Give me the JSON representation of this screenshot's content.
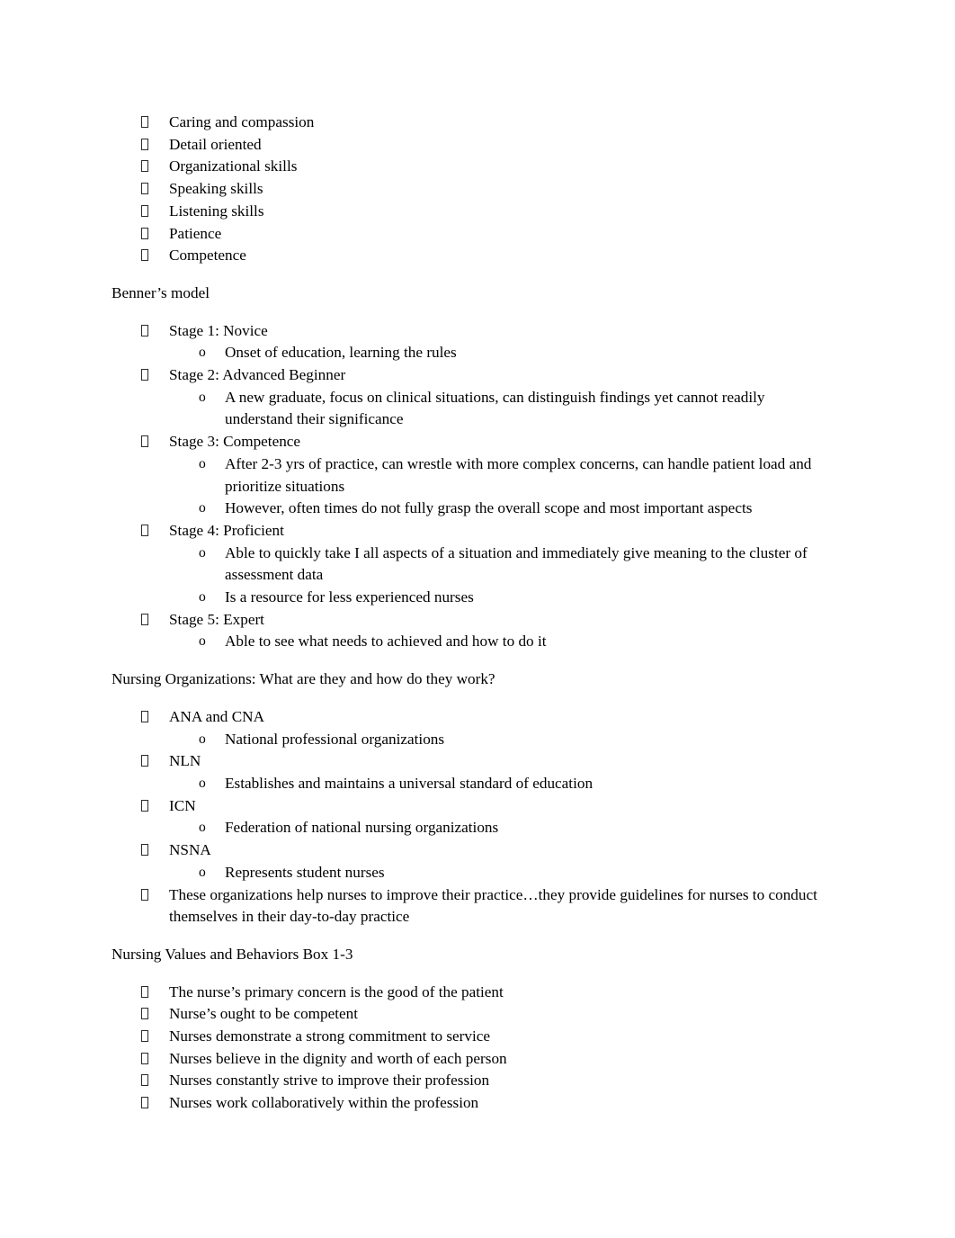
{
  "document": {
    "page_background": "#ffffff",
    "text_color": "#000000",
    "bullet_level1_glyph": "missing-glyph-box",
    "bullet_level2_glyph": "o",
    "blocks": [
      {
        "type": "list",
        "items": [
          {
            "level": 1,
            "text": "Caring and compassion"
          },
          {
            "level": 1,
            "text": "Detail oriented"
          },
          {
            "level": 1,
            "text": "Organizational skills"
          },
          {
            "level": 1,
            "text": "Speaking skills"
          },
          {
            "level": 1,
            "text": "Listening skills"
          },
          {
            "level": 1,
            "text": "Patience"
          },
          {
            "level": 1,
            "text": "Competence"
          }
        ]
      },
      {
        "type": "heading",
        "text": "Benner’s model"
      },
      {
        "type": "list",
        "items": [
          {
            "level": 1,
            "text": "Stage 1: Novice"
          },
          {
            "level": 2,
            "text": "Onset of education, learning the rules"
          },
          {
            "level": 1,
            "text": "Stage 2: Advanced Beginner"
          },
          {
            "level": 2,
            "text": "A new graduate, focus on clinical situations, can distinguish findings yet cannot readily understand their significance"
          },
          {
            "level": 1,
            "text": "Stage 3: Competence"
          },
          {
            "level": 2,
            "text": "After 2-3 yrs of practice, can wrestle with more complex concerns, can handle patient load and prioritize situations"
          },
          {
            "level": 2,
            "text": "However, often times do not fully grasp the overall scope and most important aspects"
          },
          {
            "level": 1,
            "text": "Stage 4: Proficient"
          },
          {
            "level": 2,
            "text": "Able to quickly take I all aspects of a situation and immediately give meaning to the cluster of assessment data"
          },
          {
            "level": 2,
            "text": "Is a resource for less experienced nurses"
          },
          {
            "level": 1,
            "text": "Stage 5: Expert"
          },
          {
            "level": 2,
            "text": "Able to see what needs to achieved and how to do it"
          }
        ]
      },
      {
        "type": "heading",
        "text": "Nursing Organizations: What are they and how do they work?"
      },
      {
        "type": "list",
        "items": [
          {
            "level": 1,
            "text": "ANA and CNA"
          },
          {
            "level": 2,
            "text": "National professional organizations"
          },
          {
            "level": 1,
            "text": "NLN"
          },
          {
            "level": 2,
            "text": "Establishes and maintains a universal standard of education"
          },
          {
            "level": 1,
            "text": "ICN"
          },
          {
            "level": 2,
            "text": "Federation of national nursing organizations"
          },
          {
            "level": 1,
            "text": "NSNA"
          },
          {
            "level": 2,
            "text": "Represents student nurses"
          },
          {
            "level": 1,
            "text": "These organizations help nurses to improve their practice…they provide guidelines for nurses to conduct themselves in their day-to-day practice"
          }
        ]
      },
      {
        "type": "heading",
        "text": "Nursing Values and Behaviors Box 1-3"
      },
      {
        "type": "list",
        "items": [
          {
            "level": 1,
            "text": "The nurse’s primary concern is the good of the patient"
          },
          {
            "level": 1,
            "text": "Nurse’s ought to be competent"
          },
          {
            "level": 1,
            "text": "Nurses demonstrate a strong commitment to service"
          },
          {
            "level": 1,
            "text": "Nurses believe in the dignity and worth of each person"
          },
          {
            "level": 1,
            "text": "Nurses constantly strive to improve their profession"
          },
          {
            "level": 1,
            "text": "Nurses work collaboratively within the profession"
          }
        ]
      }
    ]
  }
}
